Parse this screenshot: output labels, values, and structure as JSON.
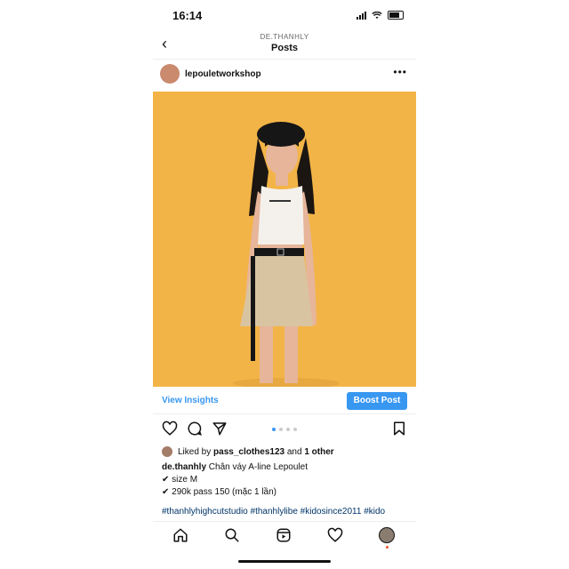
{
  "status": {
    "time": "16:14"
  },
  "nav": {
    "subtitle": "DE.THANHLY",
    "title": "Posts"
  },
  "post": {
    "username": "lepouletworkshop",
    "view_insights": "View Insights",
    "boost": "Boost Post",
    "carousel": {
      "count": 4,
      "active": 0
    },
    "likes_prefix": "Liked by ",
    "likes_user": "pass_clothes123",
    "likes_middle": " and ",
    "likes_other": "1 other",
    "caption_user": "de.thanhly",
    "caption_text": " Chân váy A-line Lepoulet",
    "caption_lines": [
      "✔ size M",
      "✔ 290k pass 150 (mặc 1 lần)"
    ],
    "hashtags": "#thanhlyhighcutstudio #thanhlylibe #kidosince2011 #kido"
  },
  "colors": {
    "photo_bg": "#f3b447",
    "accent": "#3897f0"
  }
}
